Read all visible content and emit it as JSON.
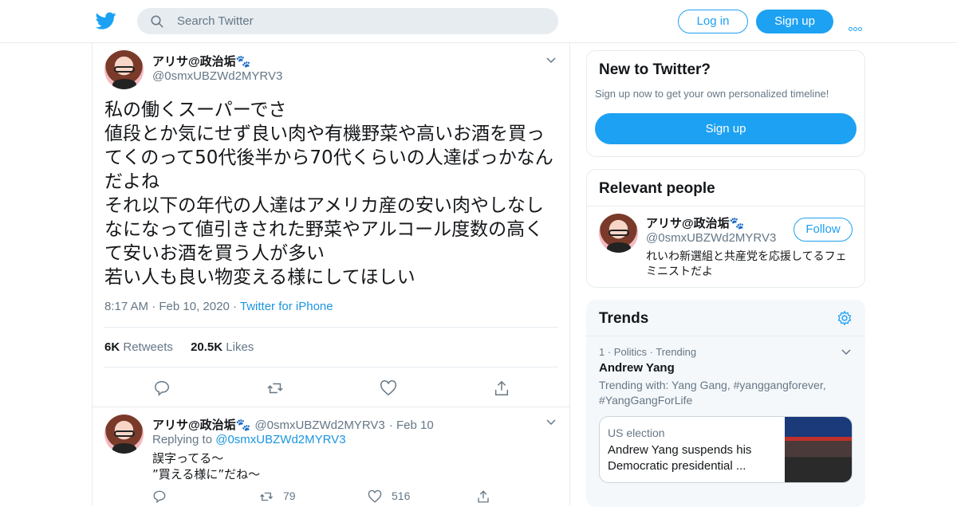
{
  "colors": {
    "accent": "#1da1f2",
    "link": "#1b95e0",
    "muted": "#657786",
    "text": "#14171a"
  },
  "header": {
    "logo_icon": "twitter-bird-icon",
    "search_placeholder": "Search Twitter",
    "login_label": "Log in",
    "signup_label": "Sign up",
    "more_icon": "more-icon"
  },
  "tweet": {
    "author_name": "アリサ@政治垢🐾",
    "author_handle": "@0smxUBZWd2MYRV3",
    "text": "私の働くスーパーでさ\n値段とか気にせず良い肉や有機野菜や高いお酒を買ってくのって50代後半から70代くらいの人達ばっかなんだよね\nそれ以下の年代の人達はアメリカ産の安い肉やしなしなになって値引きされた野菜やアルコール度数の高くて安いお酒を買う人が多い\n若い人も良い物変える様にしてほしい",
    "time": "8:17 AM",
    "date": "Feb 10, 2020",
    "source": "Twitter for iPhone",
    "retweets_count": "6K",
    "retweets_label": "Retweets",
    "likes_count": "20.5K",
    "likes_label": "Likes"
  },
  "reply": {
    "author_name": "アリサ@政治垢🐾",
    "author_handle": "@0smxUBZWd2MYRV3",
    "date": "Feb 10",
    "replying_to_label": "Replying to",
    "replying_to_handle": "@0smxUBZWd2MYRV3",
    "text_line1": "誤字ってる〜",
    "text_line2": "”買える様に”だね〜",
    "retweets": "79",
    "likes": "516"
  },
  "new_to_twitter": {
    "title": "New to Twitter?",
    "subtitle": "Sign up now to get your own personalized timeline!",
    "signup_label": "Sign up"
  },
  "relevant_people": {
    "title": "Relevant people",
    "name": "アリサ@政治垢🐾",
    "handle": "@0smxUBZWd2MYRV3",
    "follow_label": "Follow",
    "bio": "れいわ新選組と共産党を応援してるフェミニストだよ"
  },
  "trends": {
    "title": "Trends",
    "rank": "1",
    "category": "Politics",
    "status": "Trending",
    "topic": "Andrew Yang",
    "trending_with": "Trending with: Yang Gang, #yanggangforever, #YangGangForLife",
    "news_category": "US election",
    "news_headline": "Andrew Yang suspends his Democratic presidential ..."
  }
}
